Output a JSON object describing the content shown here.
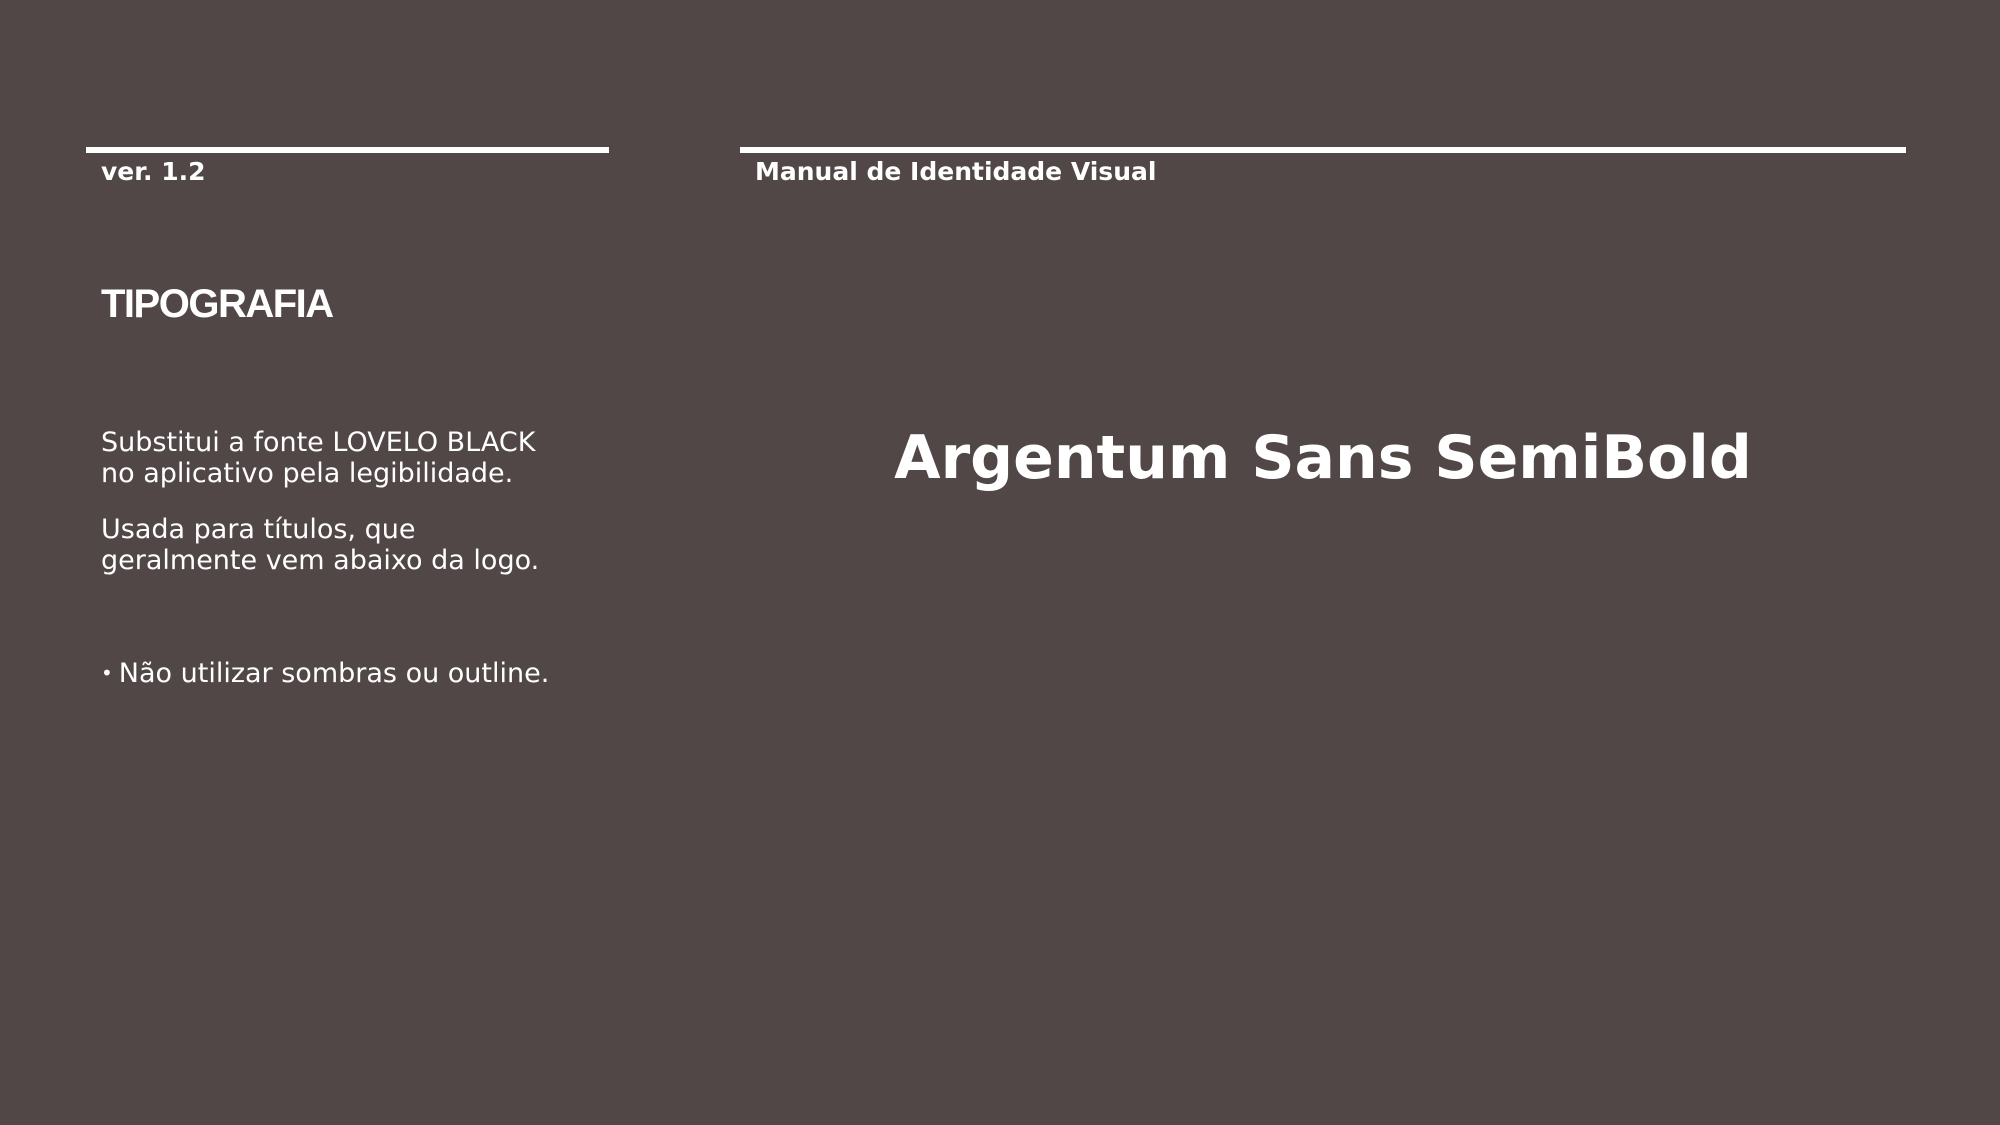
{
  "header": {
    "version": "ver. 1.2",
    "manual_title": "Manual de Identidade Visual"
  },
  "section": {
    "title": "TIPOGRAFIA"
  },
  "body": {
    "paragraph1": [
      "Substitui a fonte LOVELO BLACK",
      "no aplicativo pela legibilidade."
    ],
    "paragraph2": [
      "Usada para títulos, que",
      "geralmente vem abaixo da logo."
    ],
    "bullet_symbol": "•",
    "bullet": "Não utilizar sombras ou outline."
  },
  "font_sample": {
    "name": "Argentum Sans SemiBold"
  },
  "colors": {
    "background": "#514747",
    "foreground": "#ffffff"
  }
}
